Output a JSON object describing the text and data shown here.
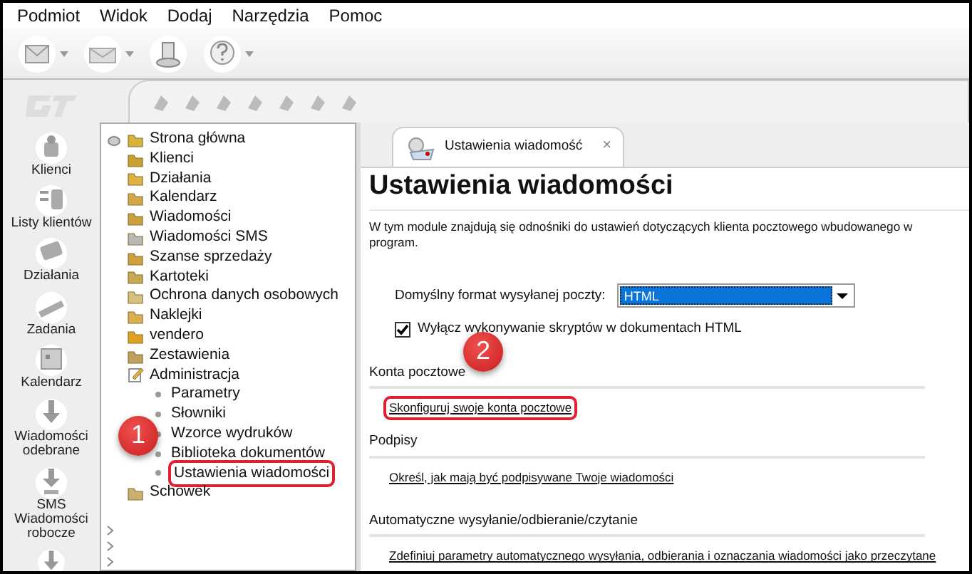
{
  "menu": [
    "Podmiot",
    "Widok",
    "Dodaj",
    "Narzędzia",
    "Pomoc"
  ],
  "rail": [
    {
      "label": "Klienci"
    },
    {
      "label": "Listy klientów"
    },
    {
      "label": "Działania"
    },
    {
      "label": "Zadania"
    },
    {
      "label": "Kalendarz"
    },
    {
      "label": "Wiadomości odebrane"
    },
    {
      "label": "SMS Wiadomości robocze"
    }
  ],
  "tree": [
    {
      "label": "Strona główna"
    },
    {
      "label": "Klienci"
    },
    {
      "label": "Działania"
    },
    {
      "label": "Kalendarz"
    },
    {
      "label": "Wiadomości"
    },
    {
      "label": "Wiadomości SMS"
    },
    {
      "label": "Szanse sprzedaży"
    },
    {
      "label": "Kartoteki"
    },
    {
      "label": "Ochrona danych osobowych"
    },
    {
      "label": "Naklejki"
    },
    {
      "label": "vendero"
    },
    {
      "label": "Zestawienia"
    },
    {
      "label": "Administracja",
      "expanded": true,
      "children": [
        {
          "label": "Parametry",
          "highlighted": false
        },
        {
          "label": "Słowniki",
          "highlighted": false
        },
        {
          "label": "Wzorce wydruków",
          "highlighted": false
        },
        {
          "label": "Biblioteka dokumentów",
          "highlighted": false
        },
        {
          "label": "Ustawienia wiadomości",
          "highlighted": true,
          "callout": "1"
        }
      ]
    },
    {
      "label": "Schowek"
    }
  ],
  "tab": {
    "label": "Ustawienia wiadomość",
    "close": "×"
  },
  "title": "Ustawienia wiadomości",
  "description": "W tym module znajdują się odnośniki do ustawień dotyczących klienta pocztowego wbudowanego w program.",
  "format": {
    "label": "Domyślny format wysyłanej poczty:",
    "value": "HTML"
  },
  "checkbox": {
    "label": "Wyłącz wykonywanie skryptów w dokumentach HTML",
    "checked": true
  },
  "sections": [
    {
      "heading": "Konta pocztowe",
      "link": "Skonfiguruj swoje konta pocztowe",
      "highlighted": true,
      "callout": "2"
    },
    {
      "heading": "Podpisy",
      "link": "Określ, jak mają być podpisywane Twoje wiadomości",
      "highlighted": false
    },
    {
      "heading": "Automatyczne wysyłanie/odbieranie/czytanie",
      "link": "Zdefiniuj parametry automatycznego wysyłania, odbierania i oznaczania wiadomości jako przeczytane",
      "highlighted": false
    }
  ]
}
